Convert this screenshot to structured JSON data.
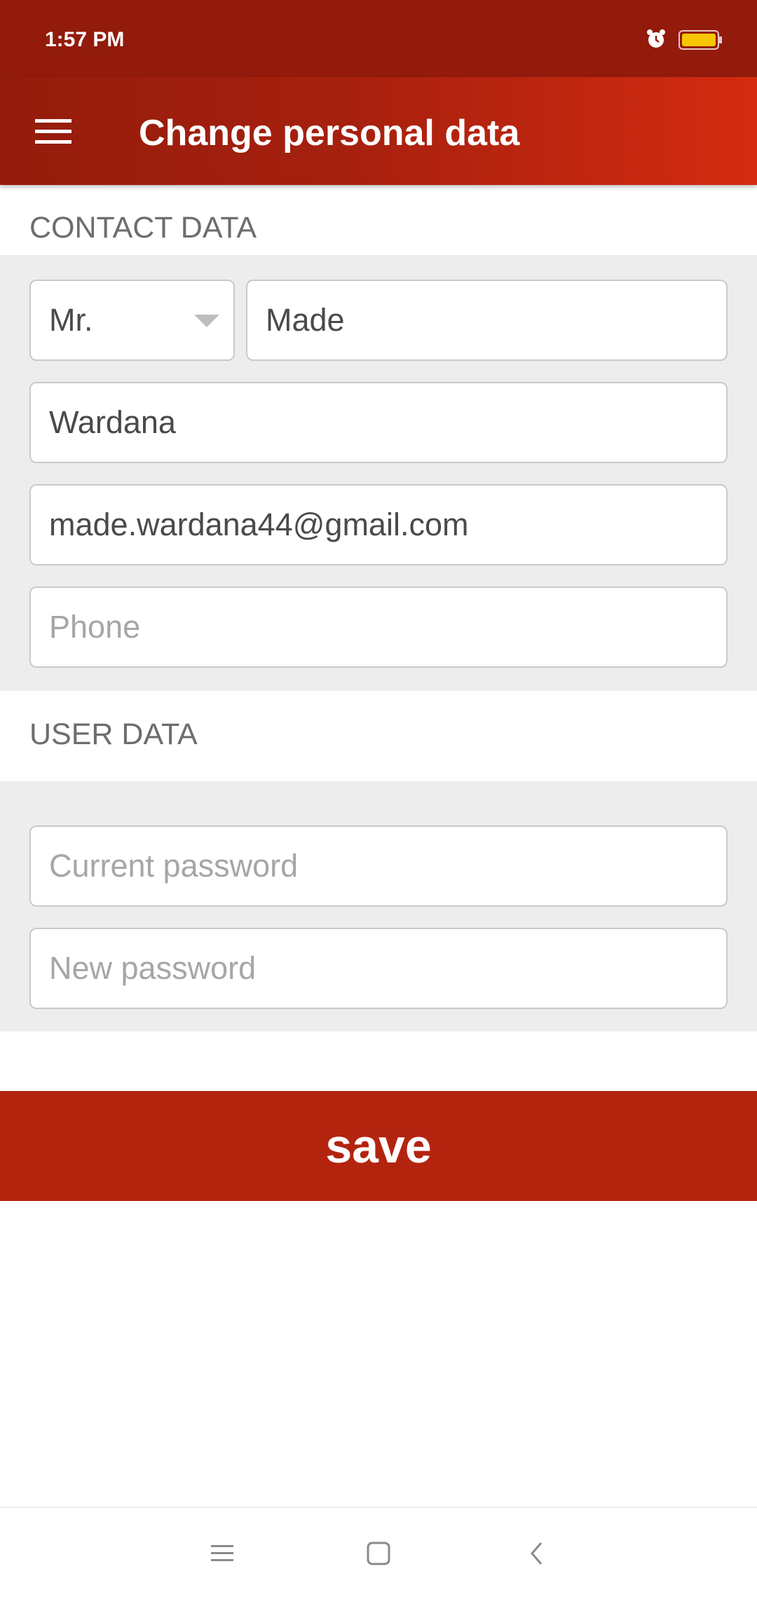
{
  "status_bar": {
    "time": "1:57 PM"
  },
  "app_bar": {
    "title": "Change personal data",
    "menu_icon": "hamburger-menu-icon"
  },
  "contact_section": {
    "heading": "CONTACT DATA",
    "salutation": "Mr.",
    "first_name": "Made",
    "last_name": "Wardana",
    "email": "made.wardana44@gmail.com",
    "phone_placeholder": "Phone"
  },
  "user_section": {
    "heading": "USER DATA",
    "current_password_placeholder": "Current password",
    "new_password_placeholder": "New password"
  },
  "save_label": "save",
  "colors": {
    "status_bar": "#931b0b",
    "app_bar_start": "#941c0c",
    "app_bar_end": "#d42b10",
    "save_button": "#b3240f",
    "panel_background": "#ededed"
  },
  "nav_bar": {
    "icons": [
      "recents-menu-icon",
      "home-square-icon",
      "back-chevron-icon"
    ]
  }
}
